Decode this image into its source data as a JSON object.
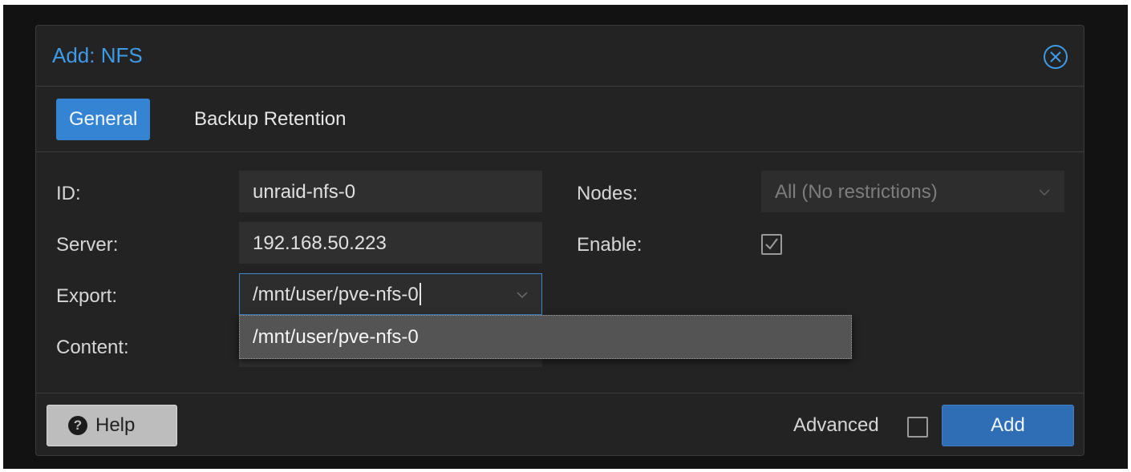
{
  "dialog": {
    "title": "Add: NFS",
    "close_icon": "circle-x-icon"
  },
  "tabs": [
    {
      "label": "General",
      "active": true
    },
    {
      "label": "Backup Retention",
      "active": false
    }
  ],
  "form": {
    "id": {
      "label": "ID:",
      "value": "unraid-nfs-0"
    },
    "server": {
      "label": "Server:",
      "value": "192.168.50.223"
    },
    "export": {
      "label": "Export:",
      "value": "/mnt/user/pve-nfs-0"
    },
    "content": {
      "label": "Content:",
      "value": ""
    },
    "nodes": {
      "label": "Nodes:",
      "value": "All (No restrictions)"
    },
    "enable": {
      "label": "Enable:",
      "checked": true
    }
  },
  "export_dropdown": {
    "options": [
      "/mnt/user/pve-nfs-0"
    ]
  },
  "footer": {
    "help_label": "Help",
    "help_icon": "question-circle-icon",
    "advanced_label": "Advanced",
    "advanced_checked": false,
    "add_label": "Add"
  },
  "colors": {
    "accent": "#3584d4",
    "title": "#3e9be9",
    "background": "#232323"
  }
}
